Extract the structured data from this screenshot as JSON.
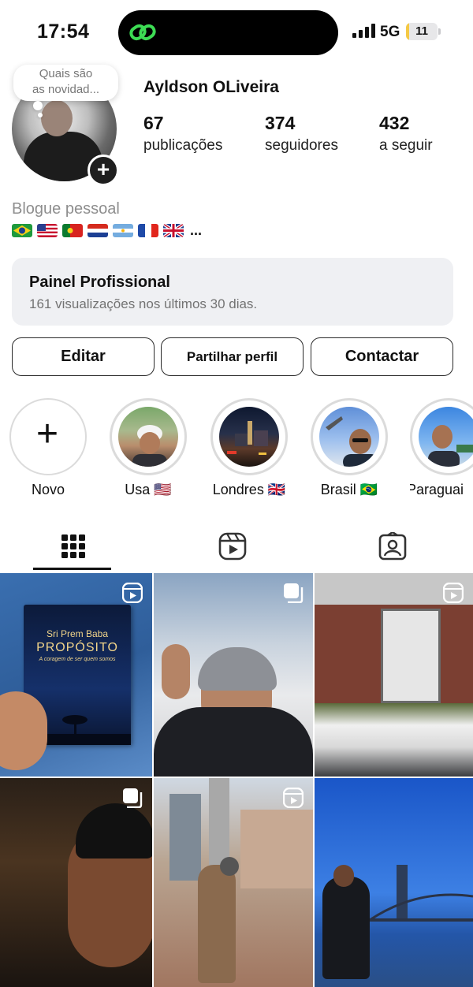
{
  "status_bar": {
    "time": "17:54",
    "network": "5G",
    "battery": "11",
    "battery_fraction": 0.11,
    "island_icon": "link-icon"
  },
  "note": {
    "text_line1": "Quais são",
    "text_line2": "as novidad..."
  },
  "profile": {
    "name": "Ayldson OLiveira",
    "stats": [
      {
        "value": "67",
        "label": "publicações"
      },
      {
        "value": "374",
        "label": "seguidores"
      },
      {
        "value": "432",
        "label": "a seguir"
      }
    ],
    "category": "Blogue pessoal",
    "flags": [
      "Brasil",
      "USA",
      "Portugal",
      "Paraguai",
      "Argentina",
      "França",
      "Reino Unido"
    ],
    "flags_ellipsis": "..."
  },
  "panel": {
    "title": "Painel Profissional",
    "subtitle": "161 visualizações nos últimos 30 dias."
  },
  "buttons": {
    "edit": "Editar",
    "share": "Partilhar perfil",
    "contact": "Contactar"
  },
  "highlights": [
    {
      "label": "Novo"
    },
    {
      "label": "Usa 🇺🇸"
    },
    {
      "label": "Londres 🇬🇧"
    },
    {
      "label": "Brasil 🇧🇷"
    },
    {
      "label": "Paraguai"
    }
  ],
  "tabs": [
    "grid-icon",
    "reels-icon",
    "tagged-icon"
  ],
  "posts": [
    {
      "badge": "reel-icon",
      "caption_author": "Sri Prem Baba",
      "caption_title": "PROPÓSITO",
      "caption_subtitle": "A coragem de ser quem somos"
    },
    {
      "badge": "carousel-icon"
    },
    {
      "badge": "reel-icon"
    },
    {
      "badge": "carousel-icon"
    },
    {
      "badge": "reel-icon"
    },
    {
      "badge": ""
    }
  ],
  "colors": {
    "accent": "#111111",
    "muted_text": "#8e8e8e",
    "panel_bg": "#eff0f3",
    "highlight_ring": "#dbdbdb",
    "island_icon": "#3ddc54",
    "battery": "#f5c945"
  }
}
